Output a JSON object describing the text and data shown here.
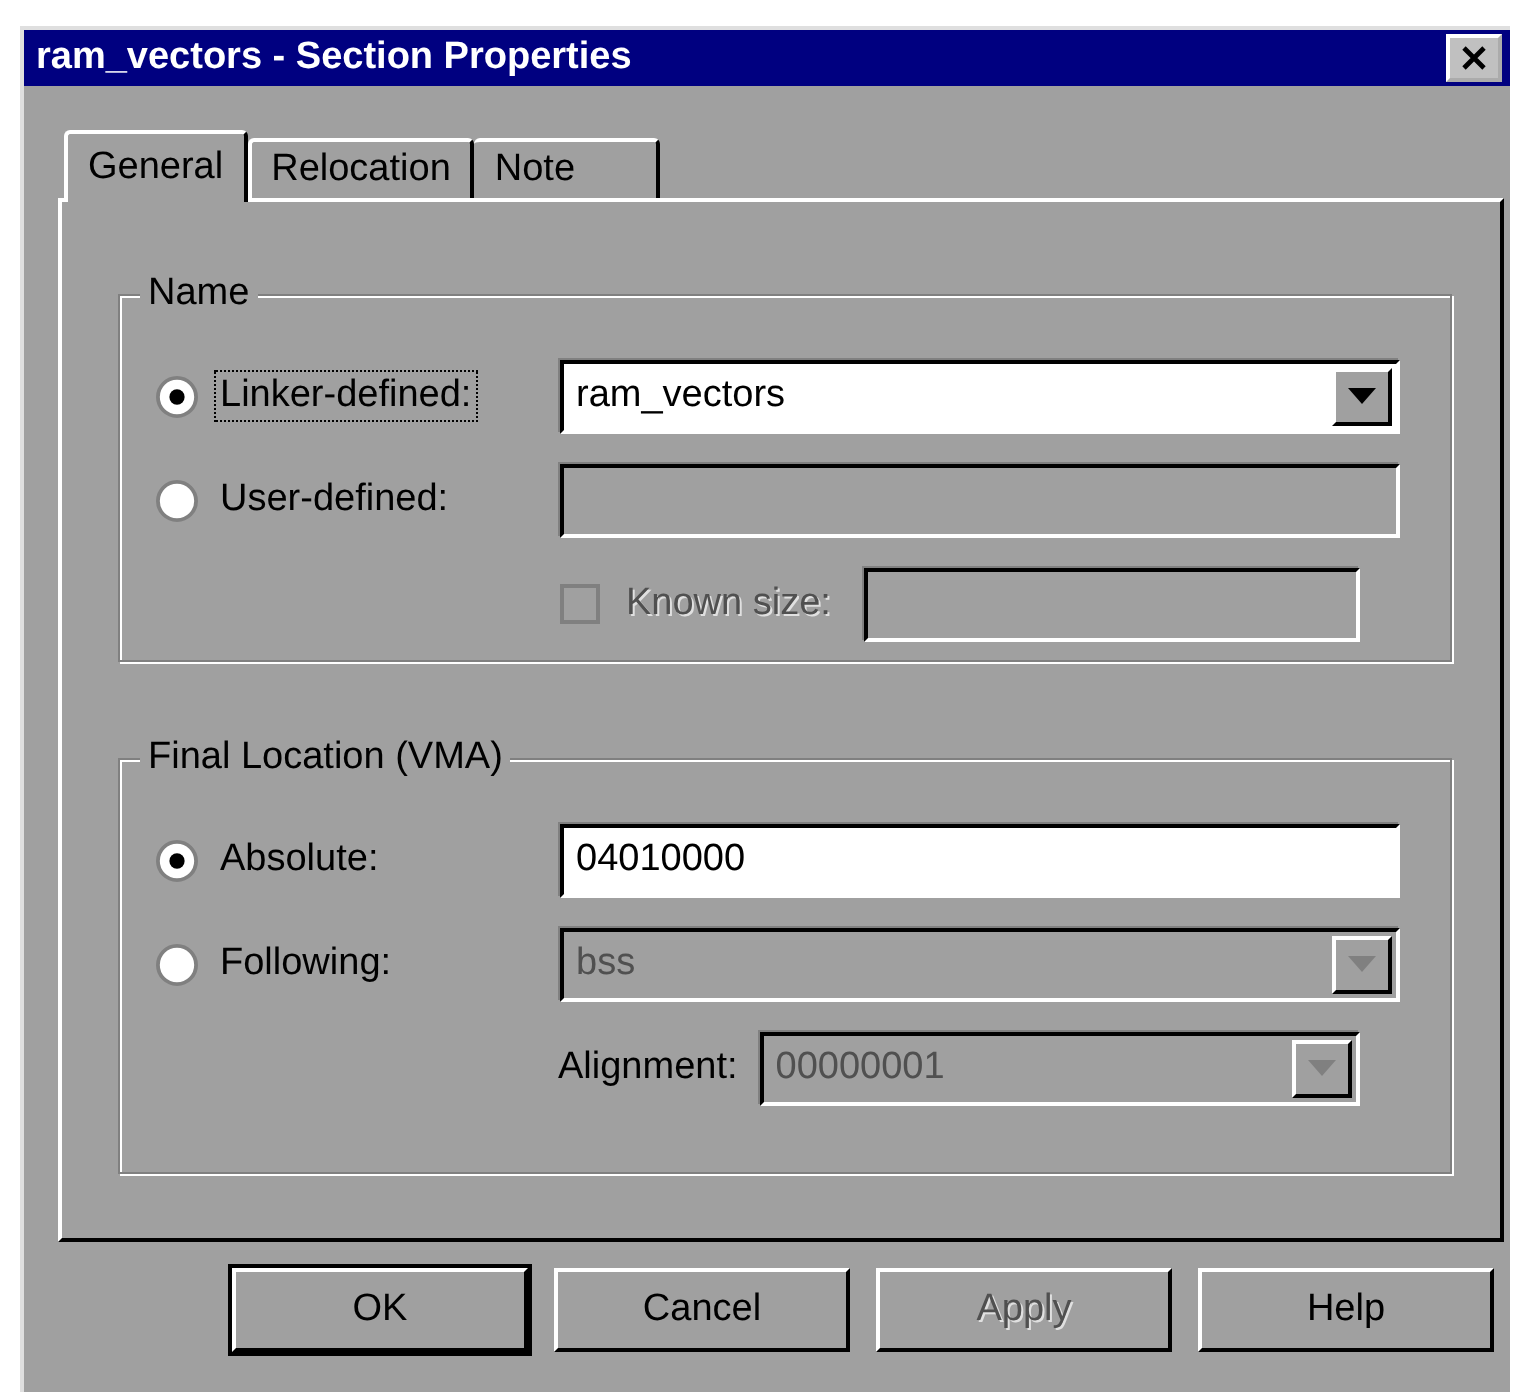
{
  "window": {
    "title": "ram_vectors - Section Properties"
  },
  "tabs": [
    {
      "label": "General",
      "selected": true
    },
    {
      "label": "Relocation",
      "selected": false
    },
    {
      "label": "Note",
      "selected": false
    }
  ],
  "name_group": {
    "legend": "Name",
    "linker": {
      "label": "Linker-defined:",
      "selected": true,
      "focused": true
    },
    "linker_combo": {
      "value": "ram_vectors",
      "disabled": false
    },
    "user": {
      "label": "User-defined:",
      "selected": false,
      "focused": false
    },
    "user_field": {
      "disabled": true
    },
    "known_size": {
      "label": "Known size:",
      "checked": false,
      "disabled": true
    },
    "known_size_field": {
      "disabled": true
    }
  },
  "location_group": {
    "legend": "Final Location (VMA)",
    "absolute": {
      "label": "Absolute:",
      "selected": true,
      "focused": false
    },
    "absolute_field": {
      "value": "04010000",
      "disabled": false
    },
    "following": {
      "label": "Following:",
      "selected": false,
      "focused": false
    },
    "following_combo": {
      "value": "bss",
      "disabled": true
    },
    "alignment": {
      "label": "Alignment:"
    },
    "alignment_combo": {
      "value": "00000001",
      "disabled": true
    }
  },
  "buttons": [
    {
      "label": "OK",
      "default": true,
      "disabled": false
    },
    {
      "label": "Cancel",
      "default": false,
      "disabled": false
    },
    {
      "label": "Apply",
      "default": false,
      "disabled": true
    },
    {
      "label": "Help",
      "default": false,
      "disabled": false
    }
  ]
}
